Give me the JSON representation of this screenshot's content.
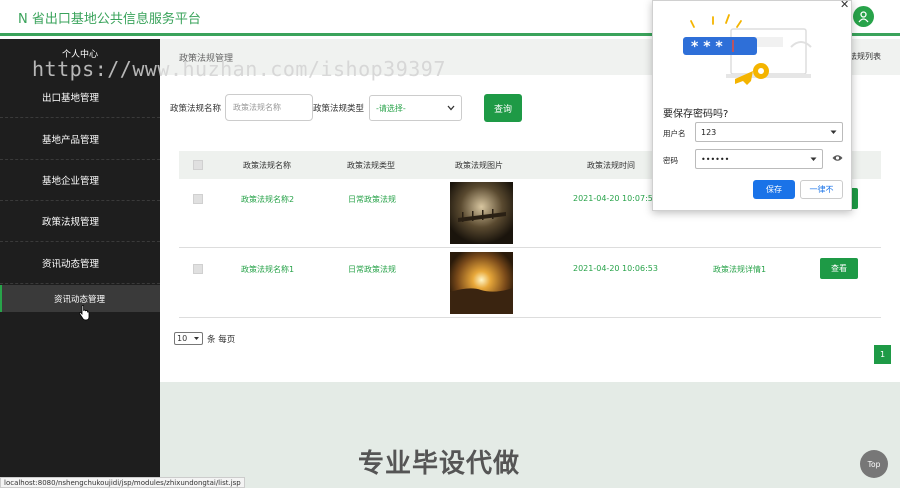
{
  "header": {
    "title": "N 省出口基地公共信息服务平台"
  },
  "watermark": "https://www.huzhan.com/ishop39397",
  "sidebar": {
    "profile": "个人中心",
    "items": [
      {
        "label": "出口基地管理"
      },
      {
        "label": "基地产品管理"
      },
      {
        "label": "基地企业管理"
      },
      {
        "label": "政策法规管理"
      },
      {
        "label": "资讯动态管理"
      }
    ],
    "active_sub": "资讯动态管理"
  },
  "breadcrumb": {
    "left": "政策法规管理",
    "right": "法规列表"
  },
  "filters": {
    "name_label": "政策法规名称",
    "name_placeholder": "政策法规名称",
    "type_label": "政策法规类型",
    "type_value": "-请选择-",
    "query_label": "查询"
  },
  "table": {
    "headers": [
      "政策法规名称",
      "政策法规类型",
      "政策法规图片",
      "政策法规时间"
    ],
    "rows": [
      {
        "name": "政策法规名称2",
        "type": "日常政策法规",
        "time": "2021-04-20 10:07:5",
        "detail": "",
        "action": ""
      },
      {
        "name": "政策法规名称1",
        "type": "日常政策法规",
        "time": "2021-04-20 10:06:53",
        "detail": "政策法规详情1",
        "action": "查看"
      }
    ]
  },
  "pagination": {
    "page_size": "10",
    "per_page_label": "条 每页",
    "current_page": "1"
  },
  "promo": "专业毕设代做",
  "status_url": "localhost:8080/nshengchukoujidi/jsp/modules/zhixundongtai/list.jsp",
  "top_button": "Top",
  "password_popup": {
    "title": "要保存密码吗?",
    "username_label": "用户名",
    "username_value": "123",
    "password_label": "密码",
    "password_value": "••••••",
    "save_label": "保存",
    "never_label": "一律不",
    "graphic_text": "* * *"
  }
}
